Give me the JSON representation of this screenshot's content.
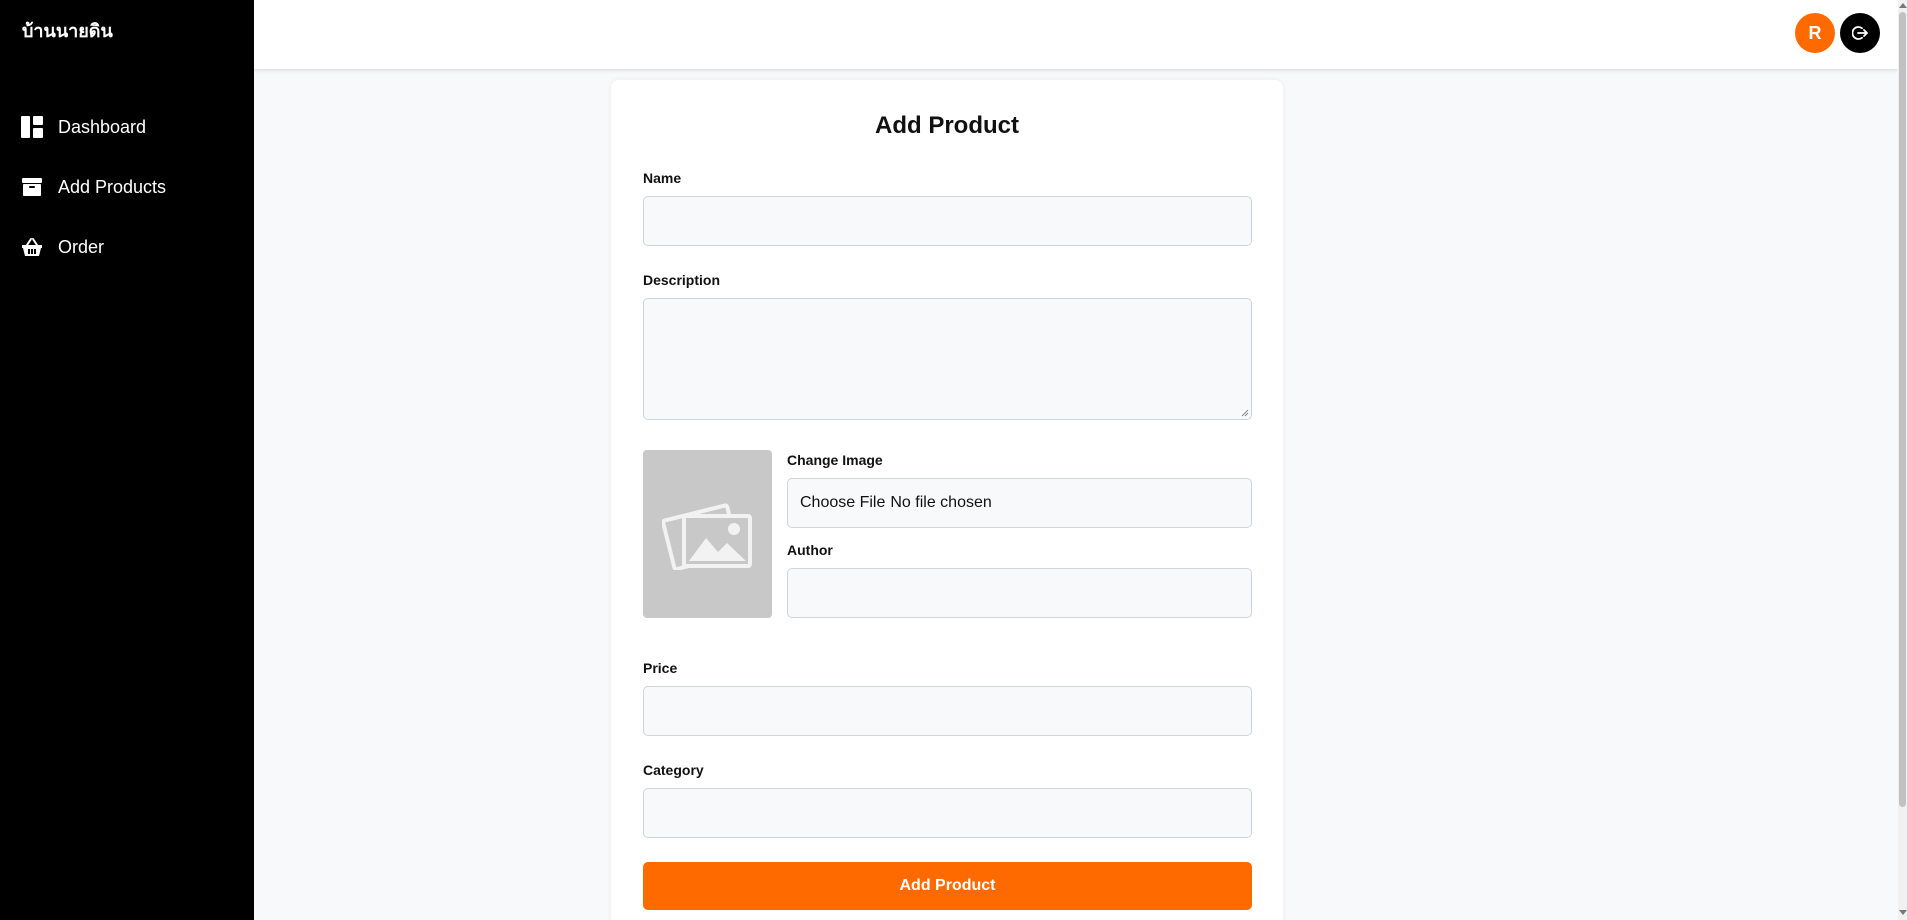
{
  "app": {
    "brand": "บ้านนายดิน"
  },
  "sidebar": {
    "items": [
      {
        "label": "Dashboard",
        "icon": "dashboard-icon"
      },
      {
        "label": "Add Products",
        "icon": "archive-box-icon"
      },
      {
        "label": "Order",
        "icon": "basket-icon"
      }
    ]
  },
  "header": {
    "avatar_initial": "R",
    "logout_icon": "logout-icon"
  },
  "form": {
    "title": "Add Product",
    "name_label": "Name",
    "name_value": "",
    "description_label": "Description",
    "description_value": "",
    "image_placeholder_icon": "image-placeholder-icon",
    "change_image_label": "Change Image",
    "file_button": "Choose File",
    "file_status": "No file chosen",
    "author_label": "Author",
    "author_value": "",
    "price_label": "Price",
    "price_value": "",
    "category_label": "Category",
    "category_value": "",
    "submit_label": "Add Product"
  },
  "colors": {
    "accent": "#ff6a00",
    "sidebar_bg": "#000000",
    "page_bg": "#f8f9fa"
  }
}
